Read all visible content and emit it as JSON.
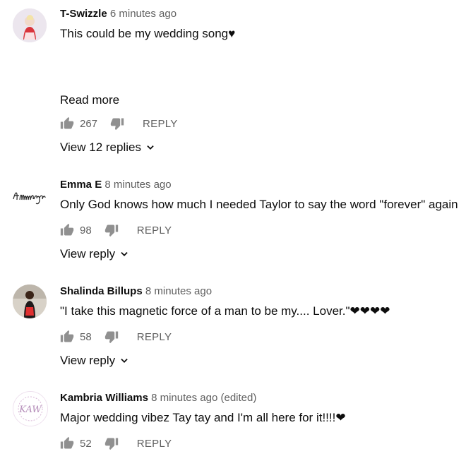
{
  "comments": [
    {
      "author": "T-Swizzle",
      "time": "6 minutes ago",
      "text": "This could be my wedding song♥",
      "read_more": "Read more",
      "likes": "267",
      "reply_label": "REPLY",
      "view_replies": "View 12 replies"
    },
    {
      "author": "Emma E",
      "time": "8 minutes ago",
      "text": "Only God knows how much I needed Taylor to say the word \"forever\" again",
      "likes": "98",
      "reply_label": "REPLY",
      "view_replies": "View reply"
    },
    {
      "author": "Shalinda Billups",
      "time": "8 minutes ago",
      "text": "\"I take this magnetic force of a man to be my.... Lover.\"❤❤❤❤",
      "likes": "58",
      "reply_label": "REPLY",
      "view_replies": "View reply"
    },
    {
      "author": "Kambria Williams",
      "time": "8 minutes ago (edited)",
      "text": "Major wedding vibez Tay tay and I'm all here for it!!!!❤",
      "likes": "52",
      "reply_label": "REPLY",
      "avatar_text": "KAW"
    }
  ]
}
